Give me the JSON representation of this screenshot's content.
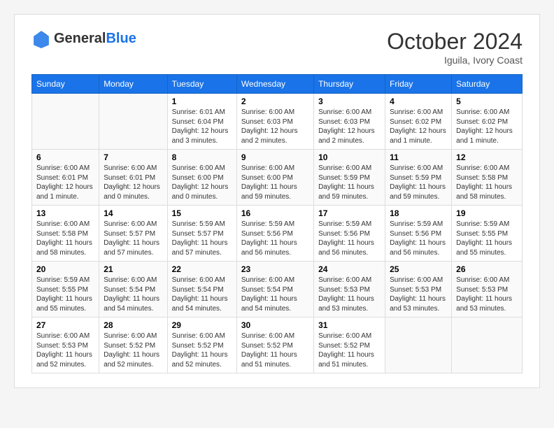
{
  "logo": {
    "text1": "General",
    "text2": "Blue"
  },
  "title": "October 2024",
  "subtitle": "Iguila, Ivory Coast",
  "days_of_week": [
    "Sunday",
    "Monday",
    "Tuesday",
    "Wednesday",
    "Thursday",
    "Friday",
    "Saturday"
  ],
  "weeks": [
    [
      {
        "day": "",
        "detail": ""
      },
      {
        "day": "",
        "detail": ""
      },
      {
        "day": "1",
        "detail": "Sunrise: 6:01 AM\nSunset: 6:04 PM\nDaylight: 12 hours and 3 minutes."
      },
      {
        "day": "2",
        "detail": "Sunrise: 6:00 AM\nSunset: 6:03 PM\nDaylight: 12 hours and 2 minutes."
      },
      {
        "day": "3",
        "detail": "Sunrise: 6:00 AM\nSunset: 6:03 PM\nDaylight: 12 hours and 2 minutes."
      },
      {
        "day": "4",
        "detail": "Sunrise: 6:00 AM\nSunset: 6:02 PM\nDaylight: 12 hours and 1 minute."
      },
      {
        "day": "5",
        "detail": "Sunrise: 6:00 AM\nSunset: 6:02 PM\nDaylight: 12 hours and 1 minute."
      }
    ],
    [
      {
        "day": "6",
        "detail": "Sunrise: 6:00 AM\nSunset: 6:01 PM\nDaylight: 12 hours and 1 minute."
      },
      {
        "day": "7",
        "detail": "Sunrise: 6:00 AM\nSunset: 6:01 PM\nDaylight: 12 hours and 0 minutes."
      },
      {
        "day": "8",
        "detail": "Sunrise: 6:00 AM\nSunset: 6:00 PM\nDaylight: 12 hours and 0 minutes."
      },
      {
        "day": "9",
        "detail": "Sunrise: 6:00 AM\nSunset: 6:00 PM\nDaylight: 11 hours and 59 minutes."
      },
      {
        "day": "10",
        "detail": "Sunrise: 6:00 AM\nSunset: 5:59 PM\nDaylight: 11 hours and 59 minutes."
      },
      {
        "day": "11",
        "detail": "Sunrise: 6:00 AM\nSunset: 5:59 PM\nDaylight: 11 hours and 59 minutes."
      },
      {
        "day": "12",
        "detail": "Sunrise: 6:00 AM\nSunset: 5:58 PM\nDaylight: 11 hours and 58 minutes."
      }
    ],
    [
      {
        "day": "13",
        "detail": "Sunrise: 6:00 AM\nSunset: 5:58 PM\nDaylight: 11 hours and 58 minutes."
      },
      {
        "day": "14",
        "detail": "Sunrise: 6:00 AM\nSunset: 5:57 PM\nDaylight: 11 hours and 57 minutes."
      },
      {
        "day": "15",
        "detail": "Sunrise: 5:59 AM\nSunset: 5:57 PM\nDaylight: 11 hours and 57 minutes."
      },
      {
        "day": "16",
        "detail": "Sunrise: 5:59 AM\nSunset: 5:56 PM\nDaylight: 11 hours and 56 minutes."
      },
      {
        "day": "17",
        "detail": "Sunrise: 5:59 AM\nSunset: 5:56 PM\nDaylight: 11 hours and 56 minutes."
      },
      {
        "day": "18",
        "detail": "Sunrise: 5:59 AM\nSunset: 5:56 PM\nDaylight: 11 hours and 56 minutes."
      },
      {
        "day": "19",
        "detail": "Sunrise: 5:59 AM\nSunset: 5:55 PM\nDaylight: 11 hours and 55 minutes."
      }
    ],
    [
      {
        "day": "20",
        "detail": "Sunrise: 5:59 AM\nSunset: 5:55 PM\nDaylight: 11 hours and 55 minutes."
      },
      {
        "day": "21",
        "detail": "Sunrise: 6:00 AM\nSunset: 5:54 PM\nDaylight: 11 hours and 54 minutes."
      },
      {
        "day": "22",
        "detail": "Sunrise: 6:00 AM\nSunset: 5:54 PM\nDaylight: 11 hours and 54 minutes."
      },
      {
        "day": "23",
        "detail": "Sunrise: 6:00 AM\nSunset: 5:54 PM\nDaylight: 11 hours and 54 minutes."
      },
      {
        "day": "24",
        "detail": "Sunrise: 6:00 AM\nSunset: 5:53 PM\nDaylight: 11 hours and 53 minutes."
      },
      {
        "day": "25",
        "detail": "Sunrise: 6:00 AM\nSunset: 5:53 PM\nDaylight: 11 hours and 53 minutes."
      },
      {
        "day": "26",
        "detail": "Sunrise: 6:00 AM\nSunset: 5:53 PM\nDaylight: 11 hours and 53 minutes."
      }
    ],
    [
      {
        "day": "27",
        "detail": "Sunrise: 6:00 AM\nSunset: 5:53 PM\nDaylight: 11 hours and 52 minutes."
      },
      {
        "day": "28",
        "detail": "Sunrise: 6:00 AM\nSunset: 5:52 PM\nDaylight: 11 hours and 52 minutes."
      },
      {
        "day": "29",
        "detail": "Sunrise: 6:00 AM\nSunset: 5:52 PM\nDaylight: 11 hours and 52 minutes."
      },
      {
        "day": "30",
        "detail": "Sunrise: 6:00 AM\nSunset: 5:52 PM\nDaylight: 11 hours and 51 minutes."
      },
      {
        "day": "31",
        "detail": "Sunrise: 6:00 AM\nSunset: 5:52 PM\nDaylight: 11 hours and 51 minutes."
      },
      {
        "day": "",
        "detail": ""
      },
      {
        "day": "",
        "detail": ""
      }
    ]
  ]
}
